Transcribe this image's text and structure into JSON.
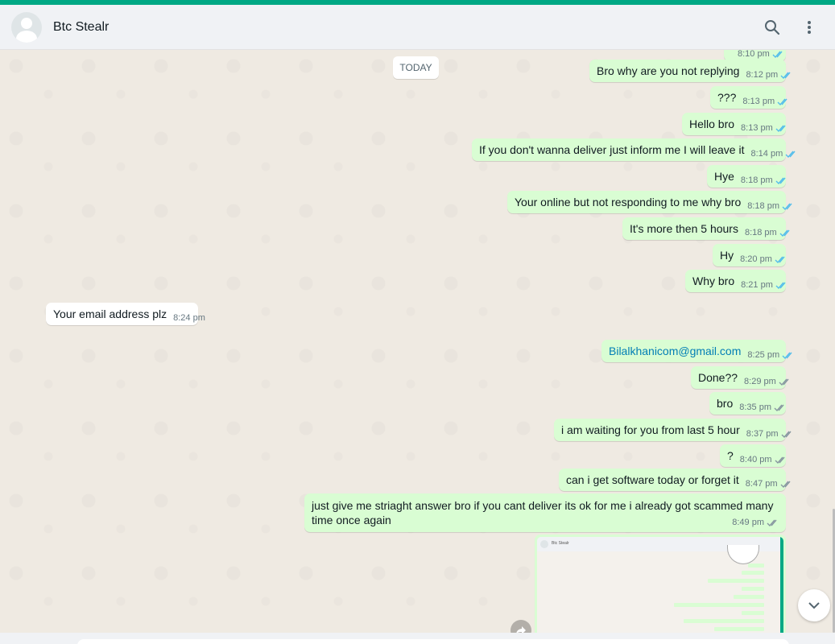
{
  "header": {
    "contact_name": "Btc Stealr",
    "search_icon": "search-icon",
    "menu_icon": "more-vertical-icon"
  },
  "colors": {
    "accent": "#00a884",
    "outgoing_bubble": "#d9fdd3",
    "incoming_bubble": "#ffffff",
    "read_ticks": "#53bdeb",
    "delivered_ticks": "#8696a0",
    "chat_background": "#efeae2"
  },
  "chat": {
    "date_divider": "TODAY",
    "partial_top_time": "8:10 pm",
    "messages": [
      {
        "text": "Bro why are you not replying",
        "time": "8:12 pm",
        "dir": "out",
        "status": "read"
      },
      {
        "text": "???",
        "time": "8:13 pm",
        "dir": "out",
        "status": "read"
      },
      {
        "text": "Hello bro",
        "time": "8:13 pm",
        "dir": "out",
        "status": "read"
      },
      {
        "text": "If you don't wanna deliver just inform me I will leave it",
        "time": "8:14 pm",
        "dir": "out",
        "status": "read"
      },
      {
        "text": "Hye",
        "time": "8:18 pm",
        "dir": "out",
        "status": "read"
      },
      {
        "text": "Your online but not responding to me why bro",
        "time": "8:18 pm",
        "dir": "out",
        "status": "read"
      },
      {
        "text": "It's more then 5 hours",
        "time": "8:18 pm",
        "dir": "out",
        "status": "read"
      },
      {
        "text": "Hy",
        "time": "8:20 pm",
        "dir": "out",
        "status": "read"
      },
      {
        "text": "Why bro",
        "time": "8:21 pm",
        "dir": "out",
        "status": "read"
      },
      {
        "text": "Your email address plz",
        "time": "8:24 pm",
        "dir": "in"
      },
      {
        "text": "Bilalkhanicom@gmail.com",
        "time": "8:25 pm",
        "dir": "out",
        "status": "read",
        "is_link": true
      },
      {
        "text": "Done??",
        "time": "8:29 pm",
        "dir": "out",
        "status": "delivered"
      },
      {
        "text": "bro",
        "time": "8:35 pm",
        "dir": "out",
        "status": "delivered"
      },
      {
        "text": "i am waiting for you from last 5 hour",
        "time": "8:37 pm",
        "dir": "out",
        "status": "delivered"
      },
      {
        "text": "?",
        "time": "8:40 pm",
        "dir": "out",
        "status": "delivered"
      },
      {
        "text": "can i get software today or forget it",
        "time": "8:47 pm",
        "dir": "out",
        "status": "delivered"
      },
      {
        "text": "just give me striaght answer bro if you cant deliver its ok for me i already got scammed many time once again",
        "time": "8:49 pm",
        "dir": "out",
        "status": "delivered"
      }
    ],
    "image_attachment": {
      "thumb_title": "Btc Stealr",
      "icon": "image-thumbnail-icon"
    },
    "forward_icon": "forward-icon",
    "scroll_down_icon": "chevron-down-icon"
  }
}
